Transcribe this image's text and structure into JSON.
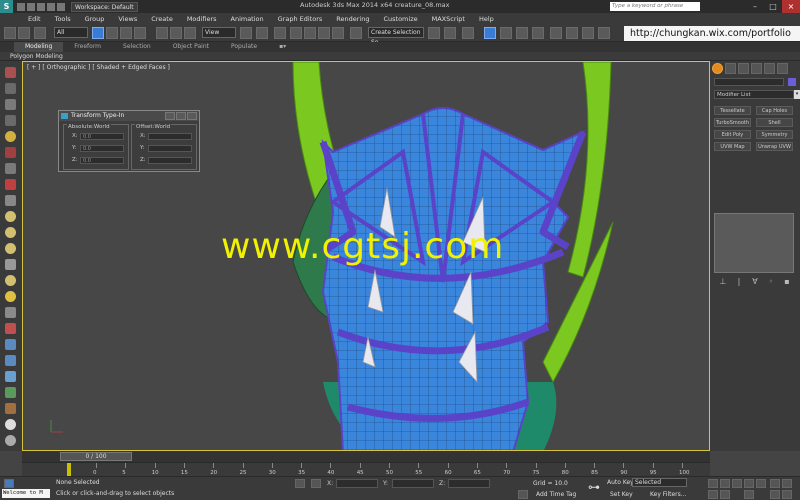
{
  "titlebar": {
    "logo": "S",
    "workspace": "Workspace: Default",
    "title": "Autodesk 3ds Max  2014 x64      creature_08.max",
    "search_placeholder": "Type a keyword or phrase",
    "min": "–",
    "max": "□",
    "close": "×"
  },
  "menu": {
    "items": [
      "Edit",
      "Tools",
      "Group",
      "Views",
      "Create",
      "Modifiers",
      "Animation",
      "Graph Editors",
      "Rendering",
      "Customize",
      "MAXScript",
      "Help"
    ]
  },
  "toolbar": {
    "filter_value": "All",
    "refcoord_value": "View",
    "selset_value": "Create Selection Se",
    "url": "http://chungkan.wix.com/portfolio"
  },
  "ribbon": {
    "tabs": [
      "Modeling",
      "Freeform",
      "Selection",
      "Object Paint",
      "Populate"
    ],
    "sub": "Polygon Modeling"
  },
  "viewport": {
    "label": "[ + ] [ Orthographic ] [ Shaded + Edged Faces ]",
    "watermark": "www.cgtsj.com"
  },
  "dialog": {
    "title": "Transform Type-In",
    "absolute_label": "Absolute:World",
    "offset_label": "Offset:World",
    "axes": [
      "X:",
      "Y:",
      "Z:"
    ],
    "value": "0.0"
  },
  "command_panel": {
    "modifier_list": "Modifier List",
    "buttons": [
      "Tessellate",
      "Cap Holes",
      "TurboSmooth",
      "Shell",
      "Edit Poly",
      "Symmetry",
      "UVW Map",
      "Unwrap UVW"
    ]
  },
  "timeline": {
    "slider": "0 / 100",
    "ticks": [
      "0",
      "5",
      "10",
      "15",
      "20",
      "25",
      "30",
      "35",
      "40",
      "45",
      "50",
      "55",
      "60",
      "65",
      "70",
      "75",
      "80",
      "85",
      "90",
      "95",
      "100"
    ]
  },
  "status": {
    "listener": "Welcome to M",
    "selection": "None Selected",
    "prompt": "Click or click-and-drag to select objects",
    "x_label": "X:",
    "y_label": "Y:",
    "z_label": "Z:",
    "grid": "Grid = 10.0",
    "add_time_tag": "Add Time Tag",
    "auto_key": "Auto Key",
    "set_key": "Set Key",
    "selected": "Selected",
    "key_filters": "Key Filters..."
  },
  "colors": {
    "armor_fill": "#3a86dc",
    "armor_trim": "#5a43c8",
    "horn_green": "#7ac820",
    "viewport_border": "#d6c43c",
    "watermark": "#f2f200"
  }
}
